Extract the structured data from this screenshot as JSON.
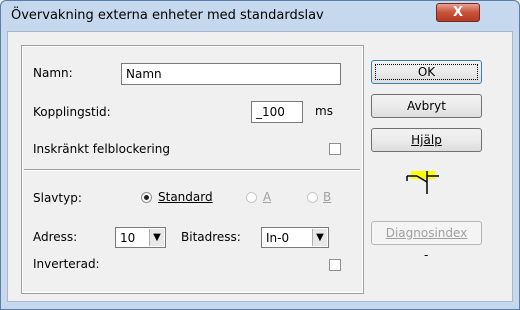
{
  "window": {
    "title": "Övervakning externa enheter med standardslav",
    "close_glyph": "X"
  },
  "form": {
    "namn_label": "Namn:",
    "namn_value": "Namn",
    "kopplingstid_label": "Kopplingstid:",
    "kopplingstid_value": "_100",
    "kopplingstid_unit": "ms",
    "inskrankt_label": "Inskränkt felblockering",
    "slavtyp_label": "Slavtyp:",
    "slavtyp_options": [
      "Standard",
      "A",
      "B"
    ],
    "slavtyp_selected": "Standard",
    "adress_label": "Adress:",
    "adress_value": "10",
    "bitadress_label": "Bitadress:",
    "bitadress_value": "In-0",
    "inverterad_label": "Inverterad:"
  },
  "buttons": {
    "ok": "OK",
    "avbryt": "Avbryt",
    "hjalp": "Hjälp",
    "diagnosindex": "Diagnosindex"
  },
  "diag_value": "-",
  "colors": {
    "titlebar": "#c6d8ee",
    "close": "#c8523a",
    "symbol_highlight": "#ffff00"
  },
  "icon": {
    "name": "contact-symbol-icon"
  }
}
